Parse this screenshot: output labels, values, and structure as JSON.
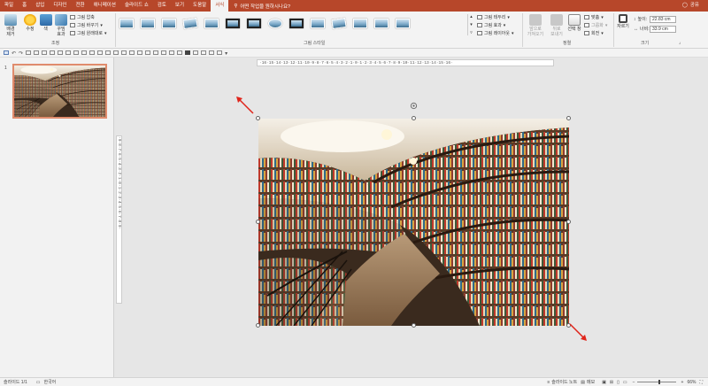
{
  "tabs": [
    "파일",
    "홈",
    "삽입",
    "디자인",
    "전환",
    "애니메이션",
    "슬라이드 쇼",
    "검토",
    "보기",
    "도움말",
    "서식"
  ],
  "active_tab": "서식",
  "tell_me": "어떤 작업을 원하시나요?",
  "share_label": "공유",
  "ribbon": {
    "adjust": {
      "remove_bg": "배경\n제거",
      "correct": "수정",
      "color": "색",
      "artistic": "꾸밈\n효과",
      "compress": "그림 압축",
      "change": "그림 바꾸기",
      "reset": "그림 원래대로",
      "group_label": "조정"
    },
    "styles": {
      "border": "그림 테두리",
      "effects": "그림 효과",
      "layout": "그림 레이아웃",
      "group_label": "그림 스타일"
    },
    "arrange": {
      "forward": "앞으로\n가져오기",
      "backward": "뒤로\n보내기",
      "pane": "선택 창",
      "align": "맞춤",
      "group": "그룹화",
      "rotate": "회전",
      "group_label": "정렬"
    },
    "size": {
      "crop": "자르기",
      "height_label": "높이:",
      "height_value": "22.83 cm",
      "width_label": "너비:",
      "width_value": "33.9 cm",
      "group_label": "크기"
    }
  },
  "slide_number": "1",
  "hruler_text": "·16·15·14·13·12·11·10·9·8·7·6·5·4·3·2·1·0·1·2·3·4·5·6·7·8·9·10·11·12·13·14·15·16·",
  "vruler_text": "·9·8·7·6·5·4·3·2·1·0·1·2·3·4·5·6·7·8·9·",
  "status": {
    "slide_info": "슬라이드 1/1",
    "language": "한국어",
    "notes": "슬라이드 노트",
    "comments": "메모",
    "zoom": "66%"
  },
  "colors": {
    "accent": "#b7472a",
    "arrow": "#e0251b"
  }
}
